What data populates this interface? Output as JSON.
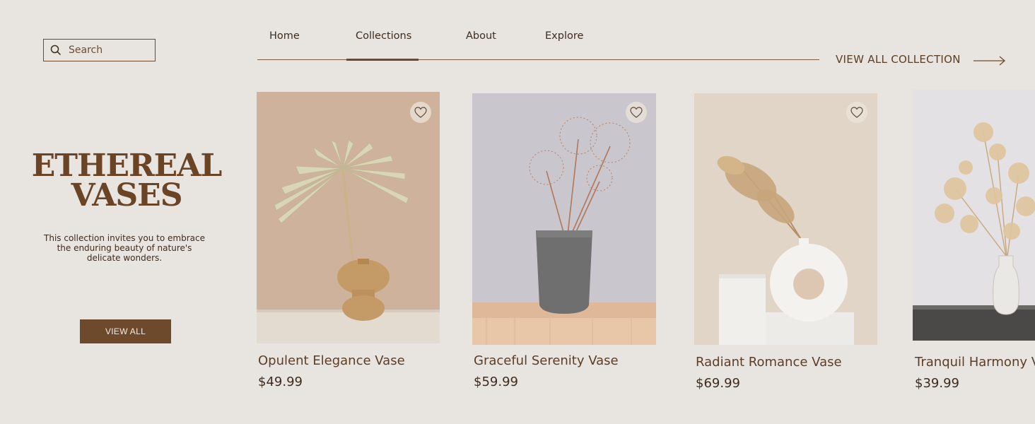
{
  "search": {
    "placeholder": "Search",
    "icon": "search-icon"
  },
  "nav": {
    "items": [
      {
        "label": "Home"
      },
      {
        "label": "Collections",
        "active": true
      },
      {
        "label": "About"
      },
      {
        "label": "Explore"
      }
    ],
    "view_all_collection": "VIEW ALL COLLECTION",
    "arrow_icon": "arrow-right-icon"
  },
  "hero": {
    "title_line1": "ETHEREAL",
    "title_line2": "VASES",
    "description": "This collection invites you to embrace the enduring beauty of nature's delicate wonders.",
    "button_label": "VIEW ALL"
  },
  "products": [
    {
      "name": "Opulent Elegance Vase",
      "price": "$49.99",
      "favorite_icon": "heart-icon"
    },
    {
      "name": "Graceful Serenity Vase",
      "price": "$59.99",
      "favorite_icon": "heart-icon"
    },
    {
      "name": "Radiant Romance Vase",
      "price": "$69.99",
      "favorite_icon": "heart-icon"
    },
    {
      "name": "Tranquil Harmony Vase",
      "price": "$39.99"
    }
  ],
  "colors": {
    "background": "#e8e4df",
    "accent": "#6e4a2c",
    "text_dark": "#3d2c1e"
  }
}
